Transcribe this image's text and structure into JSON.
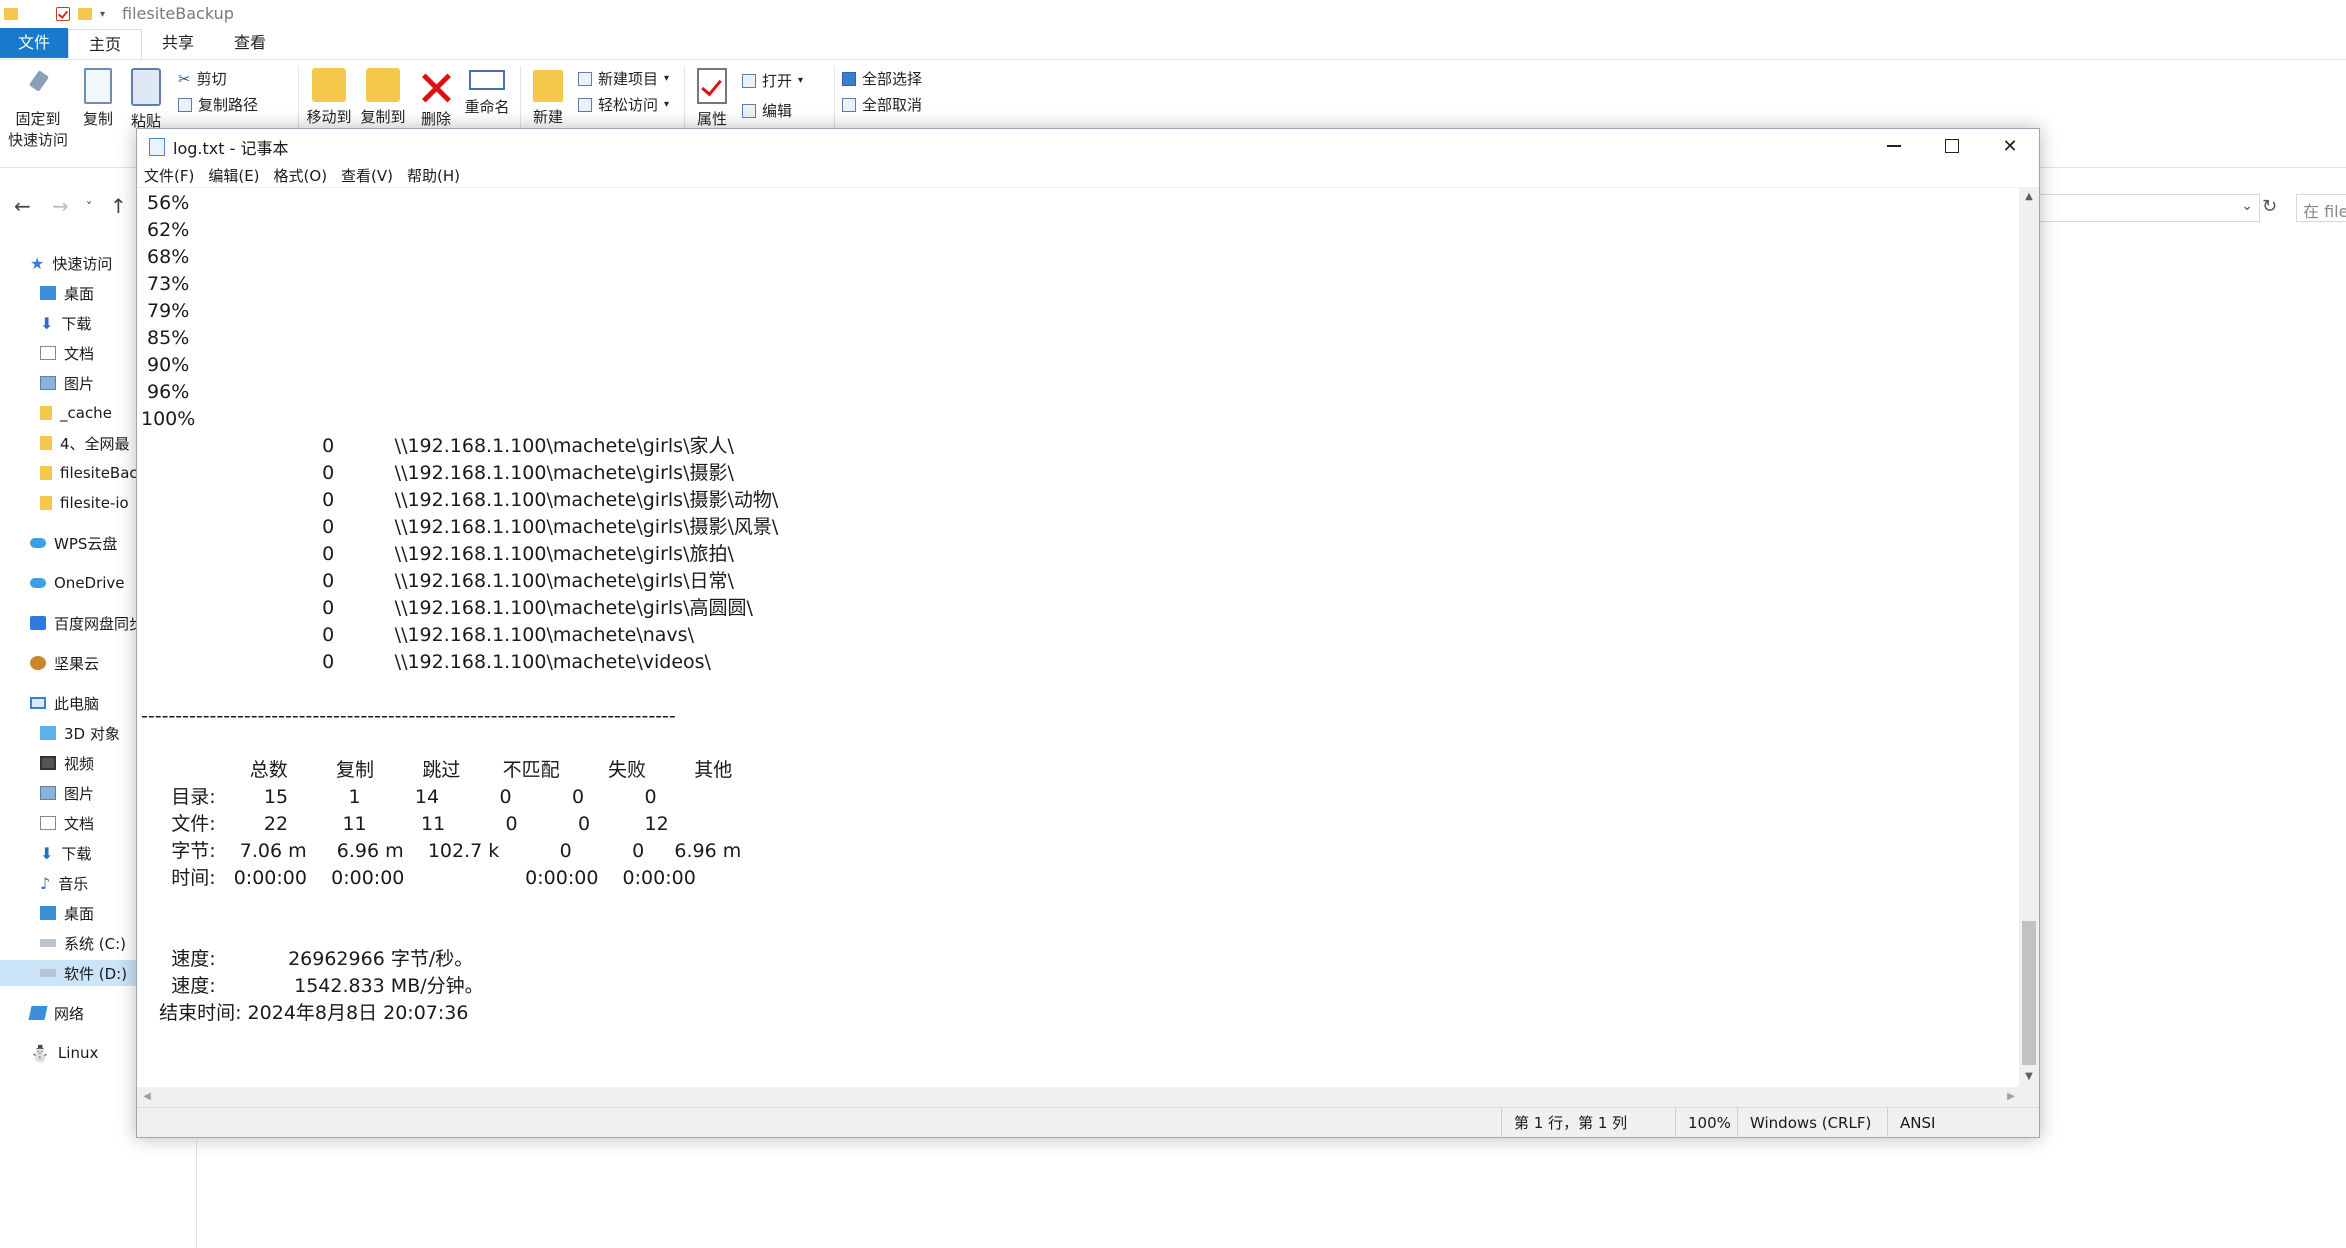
{
  "explorer": {
    "title": "filesiteBackup",
    "tabs": [
      {
        "label": "文件"
      },
      {
        "label": "主页"
      },
      {
        "label": "共享"
      },
      {
        "label": "查看"
      }
    ],
    "ribbon": {
      "pin_line1": "固定到",
      "pin_line2": "快速访问",
      "copy": "复制",
      "paste": "粘贴",
      "cut": "剪切",
      "copy_path": "复制路径",
      "move_to": "移动到",
      "copy_to": "复制到",
      "delete": "删除",
      "rename": "重命名",
      "new_folder": "新建",
      "new_item": "新建项目",
      "easy_access": "轻松访问",
      "properties": "属性",
      "open": "打开",
      "edit": "编辑",
      "select_all": "全部选择",
      "select_none": "全部取消"
    },
    "search_placeholder": "在 file",
    "sidebar": [
      {
        "label": "快速访问",
        "icon": "star-icon"
      },
      {
        "label": "桌面",
        "icon": "desktop-icon"
      },
      {
        "label": "下载",
        "icon": "download-icon"
      },
      {
        "label": "文档",
        "icon": "documents-icon"
      },
      {
        "label": "图片",
        "icon": "pictures-icon"
      },
      {
        "label": "_cache",
        "icon": "folder-icon"
      },
      {
        "label": "4、全网最",
        "icon": "folder-icon"
      },
      {
        "label": "filesiteBac",
        "icon": "folder-icon"
      },
      {
        "label": "filesite-io",
        "icon": "folder-icon"
      },
      {
        "label": "WPS云盘",
        "icon": "cloud-icon"
      },
      {
        "label": "OneDrive",
        "icon": "cloud-icon"
      },
      {
        "label": "百度网盘同步",
        "icon": "baidu-icon"
      },
      {
        "label": "坚果云",
        "icon": "nutstore-icon"
      },
      {
        "label": "此电脑",
        "icon": "computer-icon"
      },
      {
        "label": "3D 对象",
        "icon": "cube-icon"
      },
      {
        "label": "视频",
        "icon": "video-icon"
      },
      {
        "label": "图片",
        "icon": "pictures-icon"
      },
      {
        "label": "文档",
        "icon": "documents-icon"
      },
      {
        "label": "下载",
        "icon": "download-icon"
      },
      {
        "label": "音乐",
        "icon": "music-icon"
      },
      {
        "label": "桌面",
        "icon": "desktop-icon"
      },
      {
        "label": "系统 (C:)",
        "icon": "drive-icon"
      },
      {
        "label": "软件 (D:)",
        "icon": "drive-icon"
      },
      {
        "label": "网络",
        "icon": "network-icon"
      },
      {
        "label": "Linux",
        "icon": "linux-icon"
      }
    ]
  },
  "notepad": {
    "title": "log.txt - 记事本",
    "menu": [
      "文件(F)",
      "编辑(E)",
      "格式(O)",
      "查看(V)",
      "帮助(H)"
    ],
    "content": " 56%\n 62%\n 68%\n 73%\n 79%\n 85%\n 90%\n 96%\n100%\n                              0          \\\\192.168.1.100\\machete\\girls\\家人\\\n                              0          \\\\192.168.1.100\\machete\\girls\\摄影\\\n                              0          \\\\192.168.1.100\\machete\\girls\\摄影\\动物\\\n                              0          \\\\192.168.1.100\\machete\\girls\\摄影\\风景\\\n                              0          \\\\192.168.1.100\\machete\\girls\\旅拍\\\n                              0          \\\\192.168.1.100\\machete\\girls\\日常\\\n                              0          \\\\192.168.1.100\\machete\\girls\\高圆圆\\\n                              0          \\\\192.168.1.100\\machete\\navs\\\n                              0          \\\\192.168.1.100\\machete\\videos\\\n\n------------------------------------------------------------------------------\n\n                  总数        复制        跳过       不匹配        失败        其他\n     目录:        15          1         14          0          0          0\n     文件:        22         11         11          0          0         12\n     字节:    7.06 m     6.96 m    102.7 k          0          0     6.96 m\n     时间:   0:00:00    0:00:00                    0:00:00    0:00:00\n\n\n     速度:            26962966 字节/秒。\n     速度:             1542.833 MB/分钟。\n   结束时间: 2024年8月8日 20:07:36",
    "status": {
      "position": "第 1 行，第 1 列",
      "zoom": "100%",
      "line_ending": "Windows (CRLF)",
      "encoding": "ANSI"
    }
  }
}
